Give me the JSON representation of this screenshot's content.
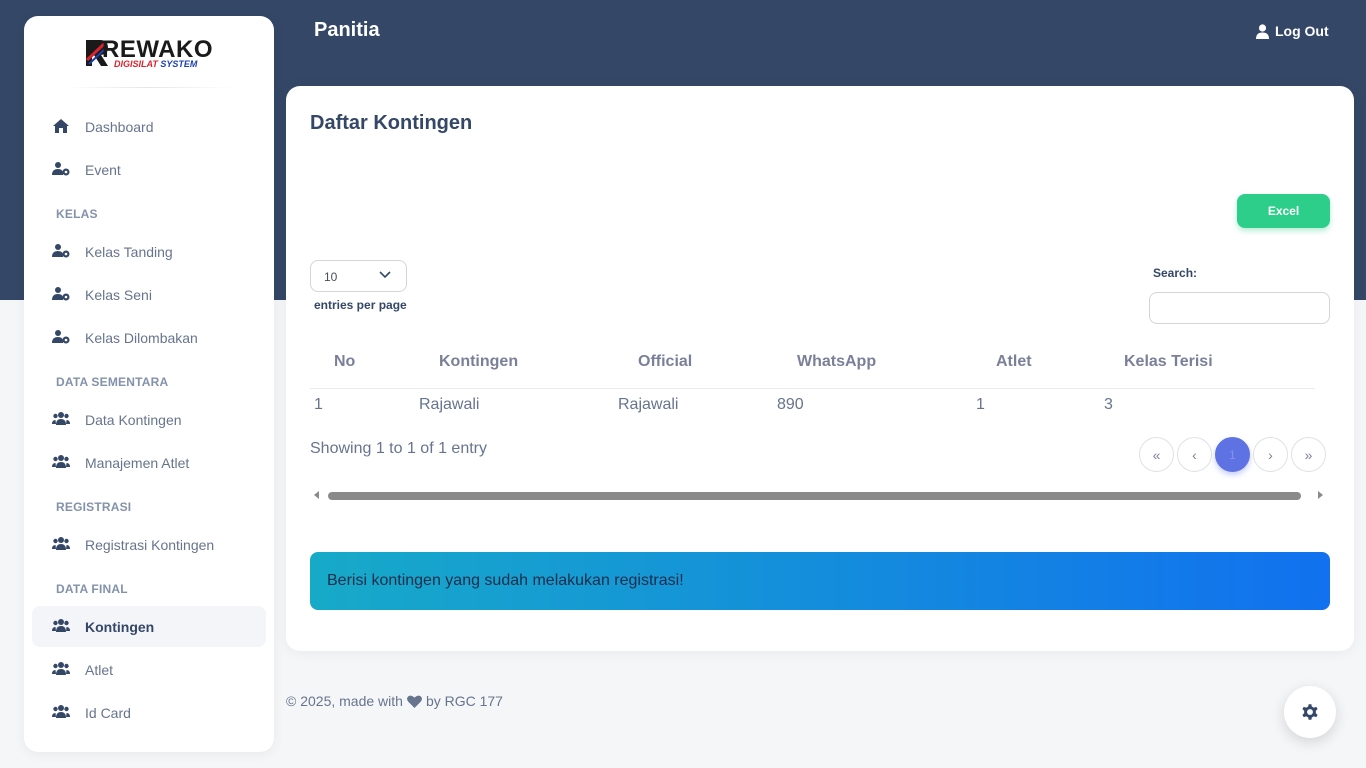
{
  "brand": {
    "name": "REWAKO",
    "subtitle_accent": "DIGISILAT",
    "subtitle": "SYSTEM"
  },
  "header": {
    "title": "Panitia",
    "logout_label": "Log Out"
  },
  "sidebar": {
    "items": [
      {
        "label": "Dashboard",
        "icon": "home-icon"
      },
      {
        "label": "Event",
        "icon": "users-cog-icon"
      },
      {
        "label": "Kelas Tanding",
        "icon": "users-cog-icon"
      },
      {
        "label": "Kelas Seni",
        "icon": "users-cog-icon"
      },
      {
        "label": "Kelas Dilombakan",
        "icon": "users-cog-icon"
      },
      {
        "label": "Data Kontingen",
        "icon": "users-icon"
      },
      {
        "label": "Manajemen Atlet",
        "icon": "users-icon"
      },
      {
        "label": "Registrasi Kontingen",
        "icon": "users-icon"
      },
      {
        "label": "Kontingen",
        "icon": "users-icon",
        "active": true
      },
      {
        "label": "Atlet",
        "icon": "users-icon"
      },
      {
        "label": "Id Card",
        "icon": "users-icon"
      }
    ],
    "sections": [
      "KELAS",
      "DATA SEMENTARA",
      "REGISTRASI",
      "DATA FINAL"
    ]
  },
  "card": {
    "title": "Daftar Kontingen",
    "excel_label": "Excel",
    "entries_value": "10",
    "entries_label": "entries per page",
    "search_label": "Search:",
    "search_value": "",
    "columns": [
      "No",
      "Kontingen",
      "Official",
      "WhatsApp",
      "Atlet",
      "Kelas Terisi"
    ],
    "rows": [
      [
        "1",
        "Rajawali",
        "Rajawali",
        "890",
        "1",
        "3"
      ]
    ],
    "showing": "Showing 1 to 1 of 1 entry",
    "pagination": {
      "first": "«",
      "prev": "‹",
      "current": "1",
      "next": "›",
      "last": "»"
    },
    "alert": "Berisi kontingen yang sudah melakukan registrasi!"
  },
  "footer": {
    "prefix": "© 2025, made with",
    "suffix": "by RGC 177"
  },
  "colors": {
    "primary": "#344767",
    "success": "#2dce89",
    "page_active": "#5e72e4",
    "alert_from": "#17aac8",
    "alert_to": "#1171ef"
  }
}
